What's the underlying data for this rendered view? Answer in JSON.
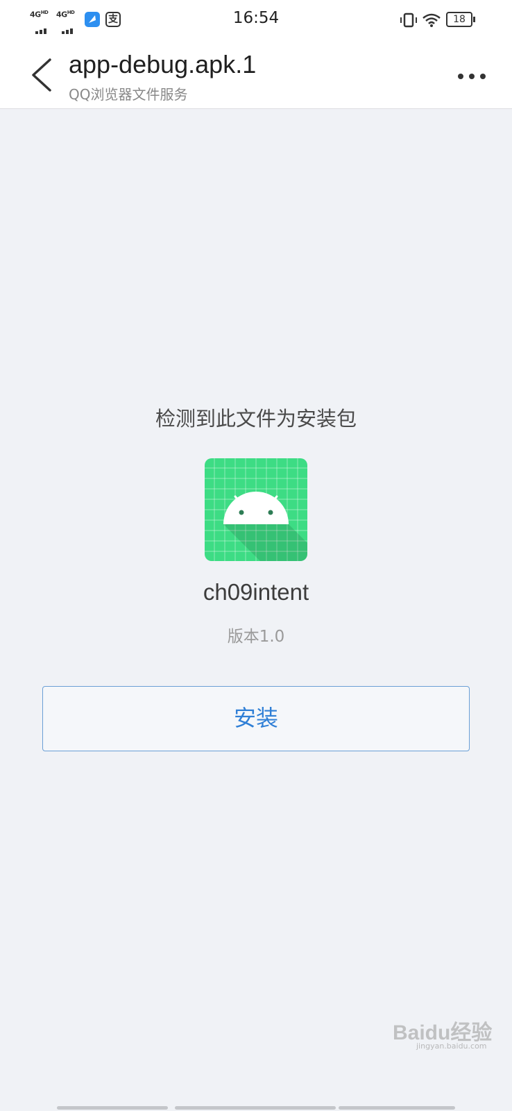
{
  "status_bar": {
    "signal_1": "4G",
    "signal_1_sup": "HD",
    "signal_2": "4G",
    "signal_2_sup": "HD",
    "app_icon_2_glyph": "支",
    "time": "16:54",
    "battery": "18"
  },
  "header": {
    "title": "app-debug.apk.1",
    "subtitle": "QQ浏览器文件服务"
  },
  "main": {
    "detect_text": "检测到此文件为安装包",
    "app_icon": "android-app-icon",
    "app_name": "ch09intent",
    "version": "版本1.0",
    "install_label": "安装"
  },
  "watermark": {
    "text": "Baidu经验",
    "subtext": "jingyan.baidu.com"
  },
  "colors": {
    "accent": "#2f7fd6",
    "icon_green": "#3ddc84",
    "background": "#f0f2f6"
  }
}
